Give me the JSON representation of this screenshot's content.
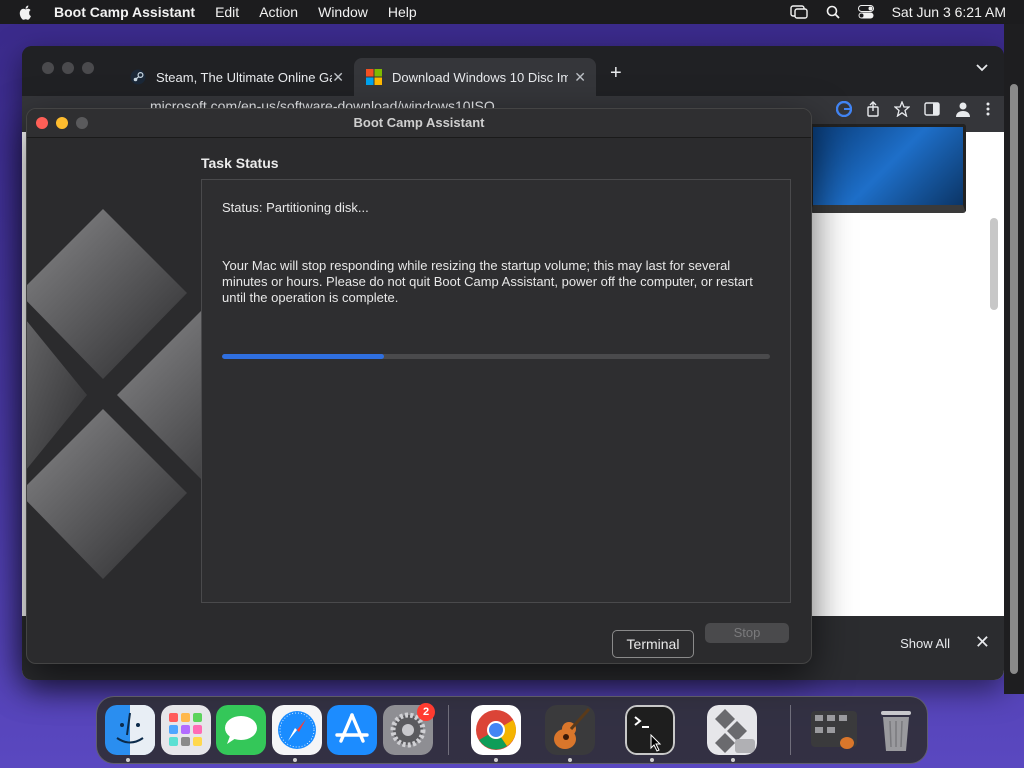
{
  "menubar": {
    "app_name": "Boot Camp Assistant",
    "items": [
      "Edit",
      "Action",
      "Window",
      "Help"
    ],
    "clock": "Sat Jun 3  6:21 AM"
  },
  "browser": {
    "tabs": [
      {
        "label": "Steam, The Ultimate Online Ga",
        "icon": "steam-icon"
      },
      {
        "label": "Download Windows 10 Disc Im",
        "icon": "windows-icon"
      }
    ],
    "url": "microsoft.com/en-us/software-download/windows10ISO",
    "download_bar": {
      "show_all": "Show All"
    }
  },
  "bootcamp": {
    "title": "Boot Camp Assistant",
    "heading": "Task Status",
    "status_text": "Status: Partitioning disk...",
    "warning_text": "Your Mac will stop responding while resizing the startup volume; this may last for several minutes or hours. Please do not quit Boot Camp Assistant, power off the computer, or restart until the operation is complete.",
    "progress_fraction": 0.295,
    "stop_label": "Stop",
    "accent_color": "#2f6fe0"
  },
  "dock": {
    "tooltip": "Terminal",
    "settings_badge": "2",
    "apps": [
      "finder-icon",
      "launchpad-icon",
      "messages-icon",
      "safari-icon",
      "app-store-icon",
      "system-settings-icon",
      "chrome-icon",
      "garageband-icon",
      "terminal-icon",
      "boot-camp-icon",
      "downloads-stack-icon",
      "trash-icon"
    ]
  }
}
